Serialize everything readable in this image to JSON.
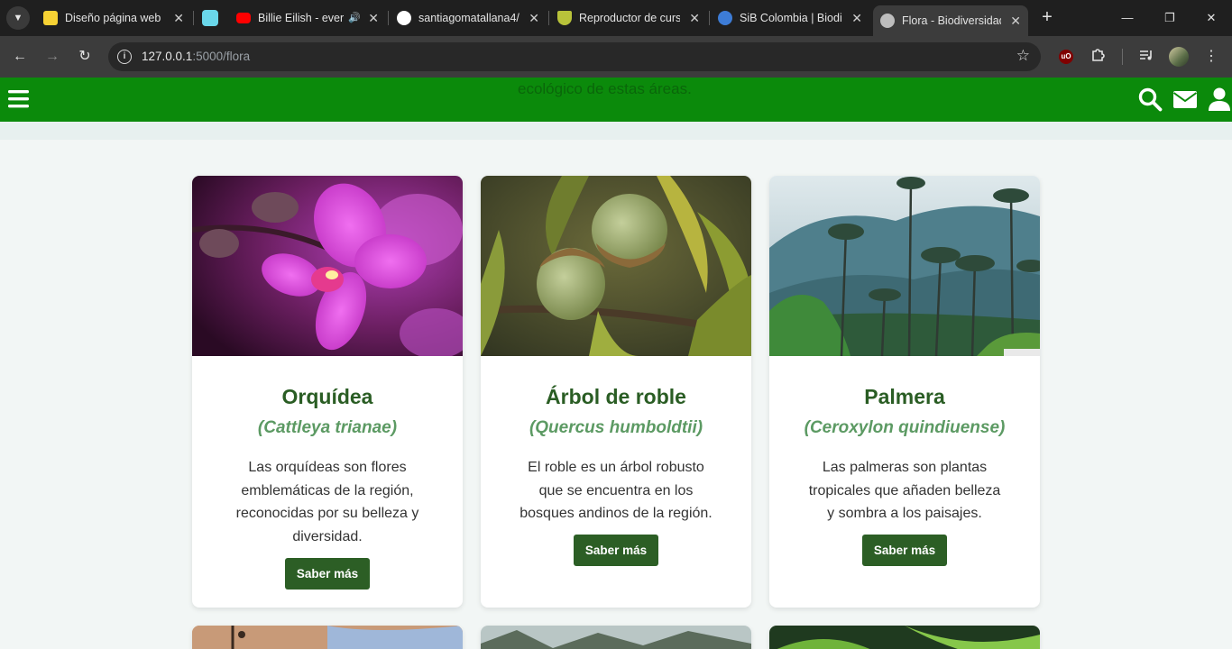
{
  "browser": {
    "tabs": [
      {
        "title": "Diseño página web",
        "favicon_color": "#f7d234"
      },
      {
        "title": "",
        "favicon_color": "#6ad7ea"
      },
      {
        "title": "Billie Eilish - ever",
        "favicon_color": "#ff0000",
        "audio": true
      },
      {
        "title": "santiagomatallana4/",
        "favicon_color": "#ffffff"
      },
      {
        "title": "Reproductor de curs",
        "favicon_color": "#b9c33a"
      },
      {
        "title": "SiB Colombia | Biodi",
        "favicon_color": "#3d7cd6"
      },
      {
        "title": "Flora - Biodiversidad",
        "favicon_color": "#bdbdbd",
        "active": true
      }
    ],
    "url_host": "127.0.0.1",
    "url_path": ":5000/flora",
    "ublock_label": "uO"
  },
  "page": {
    "navbar_color": "#0b8a0b",
    "ghost_text": "ecológico de estas áreas.",
    "cards": [
      {
        "title": "Orquídea",
        "scientific": "(Cattleya trianae)",
        "description": "Las orquídeas son flores emblemáticas de la región, reconocidas por su belleza y diversidad.",
        "button": "Saber más",
        "image": "orchid"
      },
      {
        "title": "Árbol de roble",
        "scientific": "(Quercus humboldtii)",
        "description": "El roble es un árbol robusto que se encuentra en los bosques andinos de la región.",
        "button": "Saber más",
        "image": "oak-acorns"
      },
      {
        "title": "Palmera",
        "scientific": "(Ceroxylon quindiuense)",
        "description": "Las palmeras son plantas tropicales que añaden belleza y sombra a los paisajes.",
        "button": "Saber más",
        "image": "wax-palms"
      }
    ]
  }
}
